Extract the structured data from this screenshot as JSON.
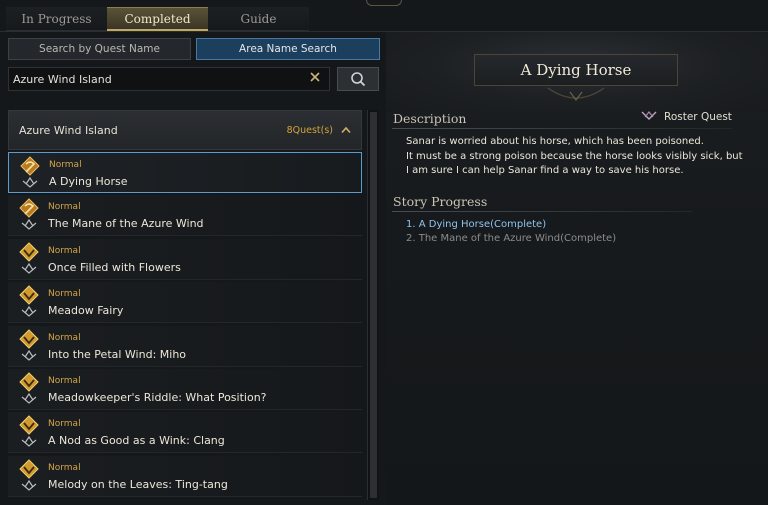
{
  "tabs": [
    {
      "label": "In Progress",
      "active": false
    },
    {
      "label": "Completed",
      "active": true
    },
    {
      "label": "Guide",
      "active": false
    }
  ],
  "search": {
    "mode_name_label": "Search by Quest Name",
    "mode_area_label": "Area Name Search",
    "active_mode": "area",
    "value": "Azure Wind Island",
    "clear_icon": "x-icon",
    "submit_icon": "search-icon"
  },
  "group": {
    "title": "Azure Wind Island",
    "count": "8Quest(s)",
    "expanded": true
  },
  "quests": [
    {
      "type": "Normal",
      "name": "A Dying Horse",
      "icon": "roster-quest-icon",
      "selected": true
    },
    {
      "type": "Normal",
      "name": "The Mane of the Azure Wind",
      "icon": "roster-quest-icon",
      "selected": false
    },
    {
      "type": "Normal",
      "name": "Once Filled with Flowers",
      "icon": "normal-quest-icon",
      "selected": false
    },
    {
      "type": "Normal",
      "name": "Meadow Fairy",
      "icon": "normal-quest-icon",
      "selected": false
    },
    {
      "type": "Normal",
      "name": "Into the Petal Wind: Miho",
      "icon": "normal-quest-icon",
      "selected": false
    },
    {
      "type": "Normal",
      "name": "Meadowkeeper's Riddle: What Position?",
      "icon": "normal-quest-icon",
      "selected": false
    },
    {
      "type": "Normal",
      "name": "A Nod as Good as a Wink: Clang",
      "icon": "normal-quest-icon",
      "selected": false
    },
    {
      "type": "Normal",
      "name": "Melody on the Leaves: Ting-tang",
      "icon": "normal-quest-icon",
      "selected": false
    }
  ],
  "detail": {
    "title": "A Dying Horse",
    "description_label": "Description",
    "roster_label": "Roster Quest",
    "description_lines": [
      "Sanar is worried about his horse, which has been poisoned.",
      "It must be a strong poison because the horse looks visibly sick, but",
      "I am sure I can help Sanar find a way to save his horse."
    ],
    "progress_label": "Story Progress",
    "progress": [
      {
        "text": "1. A Dying Horse(Complete)",
        "current": true
      },
      {
        "text": "2. The Mane of the Azure Wind(Complete)",
        "current": false
      }
    ]
  },
  "colors": {
    "accent_gold": "#d2a64a",
    "active_blue": "#1c3f5e",
    "selection_border": "#5d9bcc",
    "progress_current": "#8fc3ee"
  }
}
